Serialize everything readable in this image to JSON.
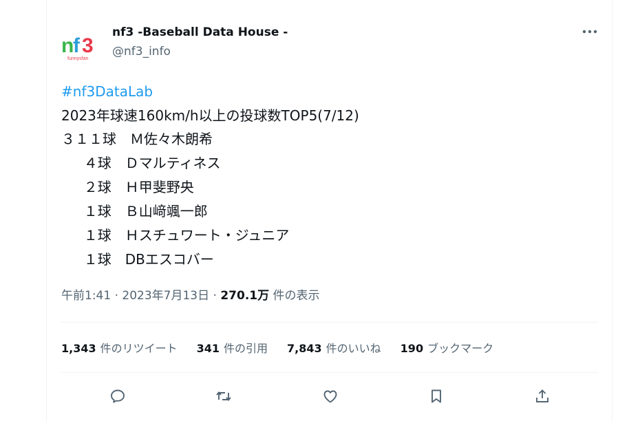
{
  "tweet": {
    "author": {
      "name": "nf3 -Baseball Data House -",
      "handle": "@nf3_info",
      "avatar_text": "nf3",
      "avatar_sub": "funnysfan"
    },
    "hashtag": "#nf3DataLab",
    "lines": [
      "2023年球速160km/h以上の投球数TOP5(7/12)",
      "３１１球　Ｍ佐々木朗希",
      "　  ４球　Ｄマルティネス",
      "　  ２球　Ｈ甲斐野央",
      "　  １球　Ｂ山﨑颯一郎",
      "　  １球　Ｈスチュワート・ジュニア",
      "　  １球　DBエスコバー"
    ],
    "meta": {
      "time": "午前1:41",
      "sep": " · ",
      "date": "2023年7月13日",
      "views": "270.1万",
      "views_label": "件の表示"
    },
    "stats": [
      {
        "num": "1,343",
        "label": "件のリツイート"
      },
      {
        "num": "341",
        "label": "件の引用"
      },
      {
        "num": "7,843",
        "label": "件のいいね"
      },
      {
        "num": "190",
        "label": "ブックマーク"
      }
    ],
    "actions": [
      "reply-icon",
      "retweet-icon",
      "like-icon",
      "bookmark-icon",
      "share-icon"
    ]
  },
  "colors": {
    "accent": "#1d9bf0",
    "text": "#0f1419",
    "muted": "#536471",
    "border": "#eff3f4"
  }
}
